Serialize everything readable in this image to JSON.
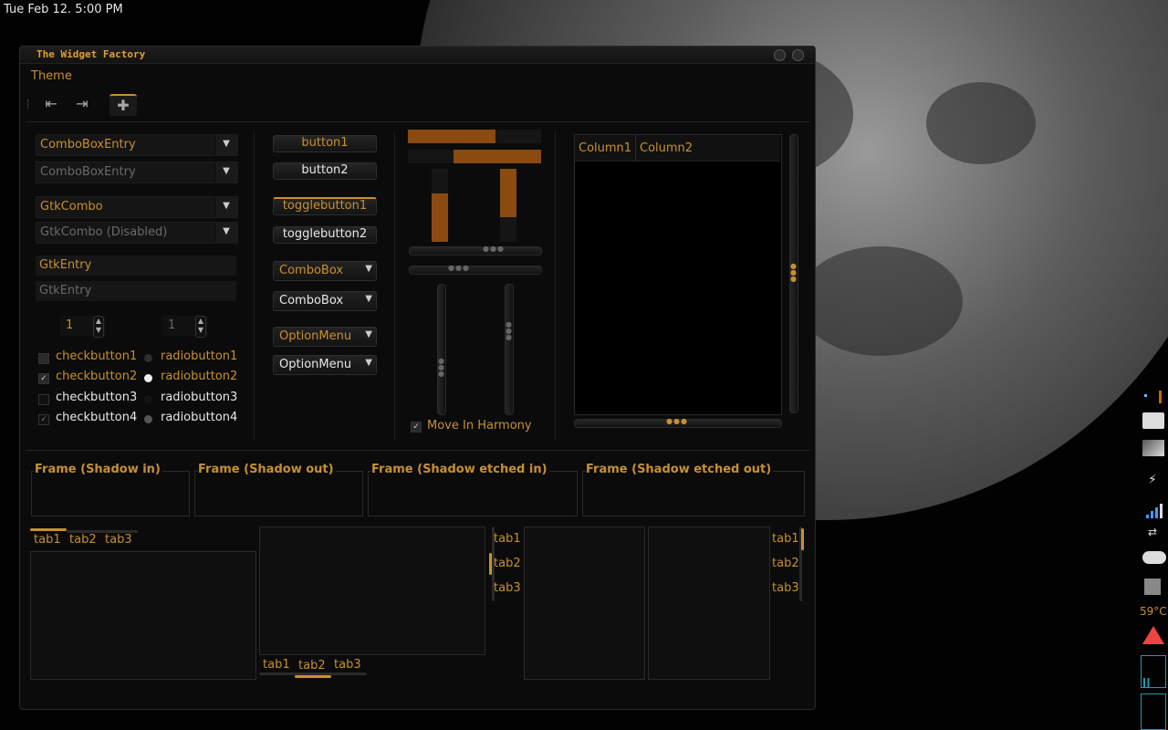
{
  "desktop": {
    "clock": "Tue Feb 12.  5:00 PM",
    "temperature": "59°C"
  },
  "window": {
    "title": "The Widget Factory",
    "menu": {
      "theme": "Theme"
    },
    "toolbar": {
      "icons": [
        "go-first-icon",
        "go-last-icon",
        "add-icon"
      ]
    }
  },
  "combos": {
    "cbe1": "ComboBoxEntry",
    "cbe2": "ComboBoxEntry",
    "gtk1": "GtkCombo",
    "gtk2": "GtkCombo (Disabled)"
  },
  "entries": {
    "e1": "GtkEntry",
    "e2": "GtkEntry"
  },
  "spins": {
    "s1": "1",
    "s2": "1"
  },
  "checks": [
    {
      "label": "checkbutton1",
      "checked": false
    },
    {
      "label": "checkbutton2",
      "checked": true
    },
    {
      "label": "checkbutton3",
      "checked": false
    },
    {
      "label": "checkbutton4",
      "checked": true
    }
  ],
  "radios": [
    {
      "label": "radiobutton1",
      "selected": false
    },
    {
      "label": "radiobutton2",
      "selected": true
    },
    {
      "label": "radiobutton3",
      "selected": false
    },
    {
      "label": "radiobutton4",
      "selected": true
    }
  ],
  "buttons": {
    "b1": "button1",
    "b2": "button2",
    "t1": "togglebutton1",
    "t2": "togglebutton2",
    "c1": "ComboBox",
    "c2": "ComboBox",
    "o1": "OptionMenu",
    "o2": "OptionMenu"
  },
  "progress": {
    "h1": 0.66,
    "h2": 0.66,
    "v1": 0.66,
    "v2": 0.66
  },
  "harmony": {
    "label": "Move In Harmony",
    "checked": true
  },
  "tree": {
    "columns": [
      "Column1",
      "Column2"
    ]
  },
  "frames": [
    "Frame (Shadow in)",
    "Frame (Shadow out)",
    "Frame (Shadow etched in)",
    "Frame (Shadow etched out)"
  ],
  "tabs": [
    "tab1",
    "tab2",
    "tab3"
  ],
  "colors": {
    "accent": "#c89030",
    "window_bg": "#0b0b0b",
    "progress_fill": "#8a4a10"
  }
}
